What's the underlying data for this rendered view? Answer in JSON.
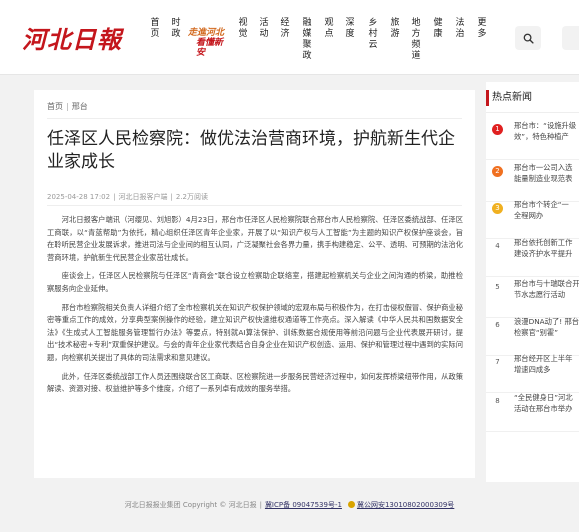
{
  "header": {
    "logo": "河北日報",
    "slogan_line1": "走進",
    "slogan_line2": "河北",
    "slogan_line3": "看懂",
    "slogan_line4": "新安",
    "nav": [
      "首页",
      "时政",
      "视觉",
      "活动",
      "经济",
      "融媒聚政",
      "观点",
      "深度",
      "乡村云",
      "旅游",
      "地方频道",
      "健康",
      "法治",
      "更多"
    ],
    "search_icon": "search-icon"
  },
  "article": {
    "breadcrumb": [
      "首页",
      "邢台"
    ],
    "title": "任泽区人民检察院：做优法治营商环境，护航新生代企业家成长",
    "date": "2025-04-28 17:02",
    "source": "河北日报客户端",
    "views": "2.2万阅读",
    "paragraphs": [
      "河北日报客户端讯（河缨见、刘旭影）4月23日，邢台市任泽区人民检察院联合邢台市人民检察院、任泽区委统战部、任泽区工商联，以“青蓝帮助”为依托，精心组织任泽区青年企业家，开展了以“知识产权与人工智能”为主题的知识产权保护座谈会，旨在聆听民营企业发展诉求，推进司法与企业间的相互认同，广泛凝聚社会各界力量，携手构建稳定、公平、透明、可预期的法治化营商环境，护航新生代民营企业家茁壮成长。",
      "座谈会上，任泽区人民检察院与任泽区“青商会”联合设立检察助企联络室，搭建起检察机关与企业之间沟通的桥梁，助推检察服务向企业延伸。",
      "邢台市检察院相关负责人详细介绍了全市检察机关在知识产权保护领域的宏观布局与积极作为，在打击侵权假冒、保护商业秘密等重点工作的成效，分享典型案例操作的经验，建立知识产权快速维权通道等工作亮点。深入解读《中华人民共和国数据安全法》《生成式人工智能服务管理暂行办法》等要点，特别就AI算法保护、训练数据合规使用等前沿问题与企业代表展开研讨，提出“技术秘密+专利”双重保护建议。与会的青年企业家代表结合自身企业在知识产权创造、运用、保护和管理过程中遇到的实际问题，向检察机关提出了具体的司法需求和意见建议。",
      "此外，任泽区委统战部工作人员还围绕联合区工商联、区检察院进一步服务民营经济过程中，如何发挥桥梁纽带作用，从政策解读、资源对接、权益维护等多个维度，介绍了一系列卓有成效的服务举措。"
    ]
  },
  "sidebar": {
    "heading": "热点新闻",
    "items": [
      {
        "num": "1",
        "color": "#e02020",
        "lines": [
          "邢台市：“设施升级",
          "效”，特色种植产"
        ]
      },
      {
        "num": "2",
        "color": "#f07020",
        "lines": [
          "邢台市一公司入选",
          "能量制造业现范表"
        ]
      },
      {
        "num": "3",
        "color": "#f0b020",
        "lines": [
          "邢台市个转企“一",
          "全程网办"
        ]
      },
      {
        "num": "4",
        "color": "",
        "lines": [
          "邢台依托创新工作",
          "建设齐护水平提升"
        ]
      },
      {
        "num": "5",
        "color": "",
        "lines": [
          "邢台市与十瑞联合开",
          "节水志愿行活动"
        ]
      },
      {
        "num": "6",
        "color": "",
        "lines": [
          "浪漫DNA动了! 邢台",
          "检察官“别霍”"
        ]
      },
      {
        "num": "7",
        "color": "",
        "lines": [
          "邢台经开区上半年",
          "增速四成多"
        ]
      },
      {
        "num": "8",
        "color": "",
        "lines": [
          "“全民健身日”河北",
          "活动在邢台市举办"
        ]
      }
    ]
  },
  "footer": {
    "copyright": "河北日报报业集团 Copyright © 河北日报",
    "icp": "冀ICP备 09047539号-1",
    "police": "冀公网安13010802000309号"
  }
}
